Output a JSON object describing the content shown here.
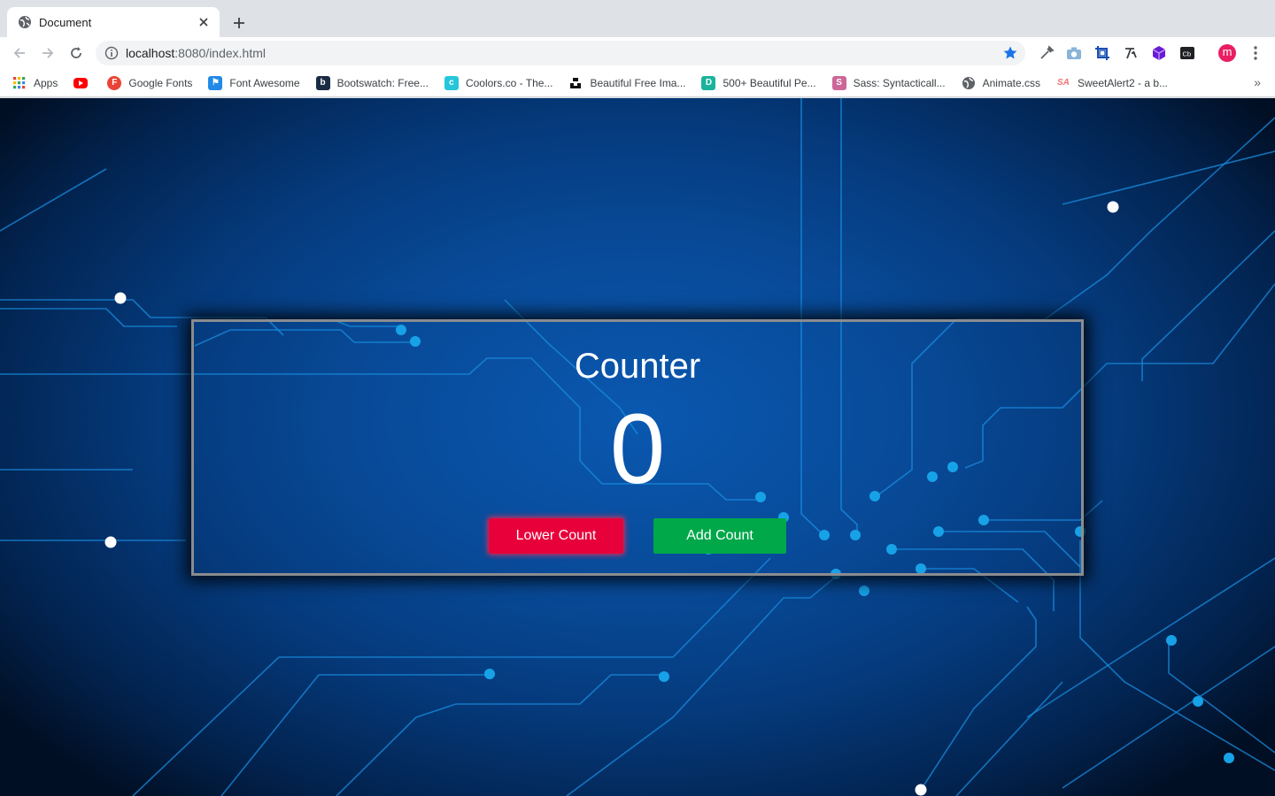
{
  "browser": {
    "tab_title": "Document",
    "url_host": "localhost",
    "url_path": ":8080/index.html",
    "profile_initial": "m"
  },
  "bookmarks": [
    {
      "label": "Apps",
      "icon": "apps-grid-icon"
    },
    {
      "label": "",
      "icon": "youtube-icon",
      "color": "#ff0000"
    },
    {
      "label": "Google Fonts",
      "icon": "google-fonts-icon",
      "color": "#ea4335"
    },
    {
      "label": "Font Awesome",
      "icon": "font-awesome-flag-icon",
      "color": "#228ae6"
    },
    {
      "label": "Bootswatch: Free...",
      "icon": "bootswatch-icon",
      "color": "#1a2b44"
    },
    {
      "label": "Coolors.co - The...",
      "icon": "coolors-icon",
      "color": "#26c6da"
    },
    {
      "label": "Beautiful Free Ima...",
      "icon": "unsplash-icon",
      "color": "#111111"
    },
    {
      "label": "500+ Beautiful Pe...",
      "icon": "doodle-icon",
      "color": "#1bb39b"
    },
    {
      "label": "Sass: Syntacticall...",
      "icon": "sass-icon",
      "color": "#cd6799"
    },
    {
      "label": "Animate.css",
      "icon": "globe-icon",
      "color": "#5f6368"
    },
    {
      "label": "SweetAlert2 - a b...",
      "icon": "sweetalert-icon",
      "color": "#f27474"
    }
  ],
  "counter": {
    "title": "Counter",
    "value": "0",
    "lower_label": "Lower Count",
    "add_label": "Add Count"
  },
  "colors": {
    "lower_button": "#e8003a",
    "add_button": "#00a84a",
    "circuit_line": "#1a8ee0",
    "circuit_dot": "#17a2e8"
  }
}
